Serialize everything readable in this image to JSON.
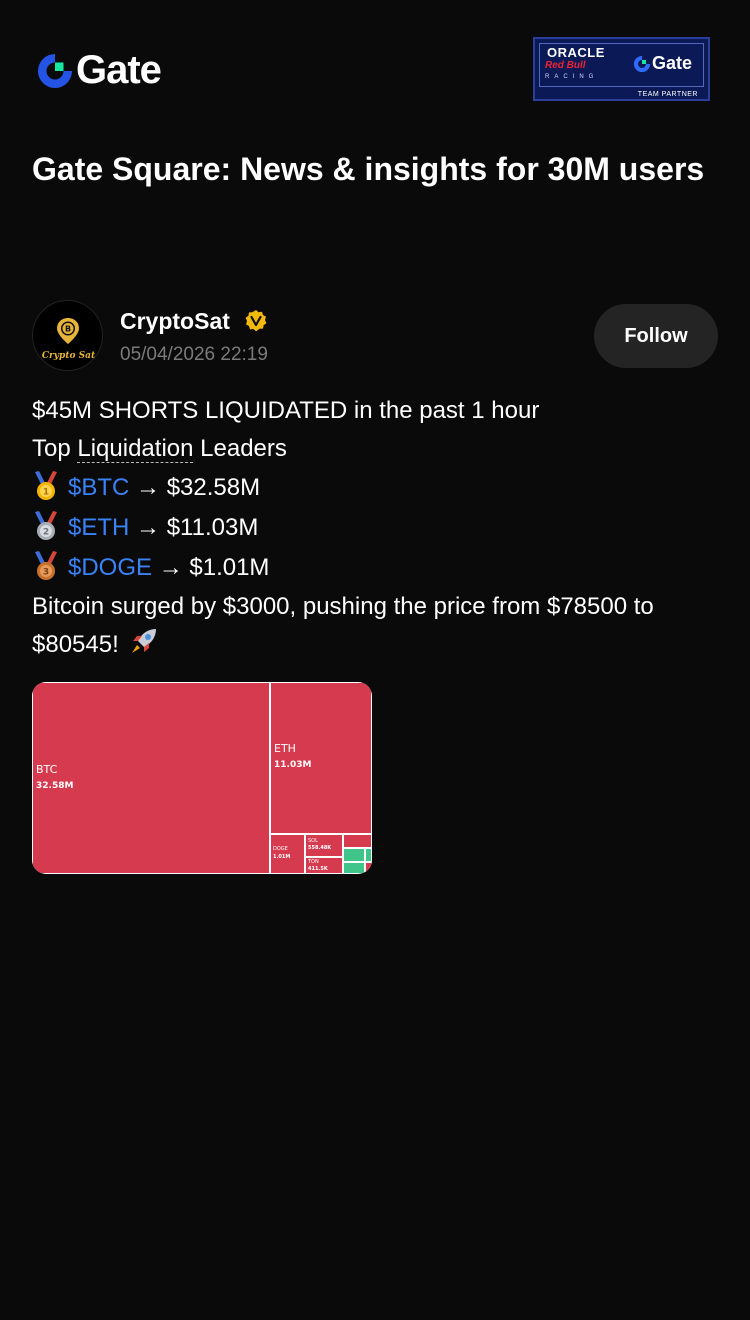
{
  "header": {
    "logo_text": "Gate",
    "partner": {
      "oracle": "ORACLE",
      "redbull": "Red Bull",
      "racing": "RACING",
      "gate": "Gate",
      "team_partner": "TEAM PARTNER"
    }
  },
  "page": {
    "title": "Gate Square: News & insights for 30M users"
  },
  "author": {
    "name": "CryptoSat",
    "avatar_label": "Crypto Sat",
    "date": "05/04/2026 22:19",
    "verified_color": "#f0b90b",
    "follow_label": "Follow"
  },
  "post": {
    "line1": "$45M SHORTS LIQUIDATED in the past 1 hour",
    "line2_prefix": "Top ",
    "line2_underlined": "Liquidation",
    "line2_suffix": " Leaders",
    "leaders": [
      {
        "medal": "gold-medal-icon",
        "ticker": "$BTC",
        "amount": " → $32.58M"
      },
      {
        "medal": "silver-medal-icon",
        "ticker": "$ETH",
        "amount": " → $11.03M"
      },
      {
        "medal": "bronze-medal-icon",
        "ticker": "$DOGE",
        "amount": " → $1.01M"
      }
    ],
    "line_last": "Bitcoin surged by $3000, pushing the price from $78500 to",
    "line_last2": "$80545! ",
    "ticker_color": "#3b82f6"
  },
  "treemap": {
    "cells": [
      {
        "name": "BTC",
        "value": "32.58M"
      },
      {
        "name": "ETH",
        "value": "11.03M"
      },
      {
        "name": "DOGE",
        "value": "1.01M"
      },
      {
        "name": "SOL",
        "value": "558.48K"
      },
      {
        "name": "TON",
        "value": "411.5K"
      }
    ],
    "colors": {
      "short": "#d63a4f",
      "long": "#3fc48a"
    }
  }
}
